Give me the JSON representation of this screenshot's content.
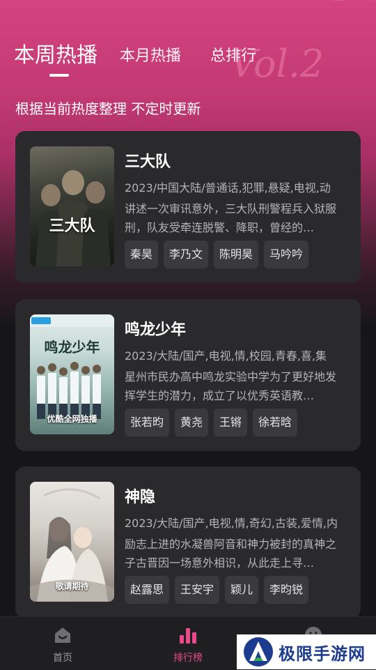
{
  "tabs": [
    {
      "label": "本周热播",
      "active": true
    },
    {
      "label": "本月热播",
      "active": false
    },
    {
      "label": "总排行",
      "active": false
    }
  ],
  "subtitle": "根据当前热度整理 不定时更新",
  "cards": [
    {
      "title": "三大队",
      "meta": "2023/中国大陆/普通话,犯罪,悬疑,电视,动",
      "desc": "讲述一次审讯意外，三大队刑警程兵入狱服刑，队友受牵连脱警、降职，曾经的…",
      "poster_title": "三大队",
      "poster_caption": "",
      "tags": [
        "秦昊",
        "李乃文",
        "陈明昊",
        "马吟吟"
      ]
    },
    {
      "title": "鸣龙少年",
      "meta": "2023/大陆/国产,电视,情,校园,青春,喜,集",
      "desc": "星州市民办高中鸣龙实验中学为了更好地发挥学生的潜力，成立了以优秀英语教…",
      "poster_title": "鸣龙少年",
      "poster_caption": "优酷全网独播",
      "tags": [
        "张若昀",
        "黄尧",
        "王锵",
        "徐若晗"
      ]
    },
    {
      "title": "神隐",
      "meta": "2023/大陆/国产,电视,情,奇幻,古装,爱情,内",
      "desc": "励志上进的水凝兽阿音和神力被封的真神之子古晋因一场意外相识，从此走上寻…",
      "poster_title": "",
      "poster_caption": "敬请期待",
      "tags": [
        "赵露思",
        "王安宇",
        "颖儿",
        "李昀锐"
      ]
    }
  ],
  "nav": [
    {
      "label": "首页",
      "icon": "home-icon",
      "active": false
    },
    {
      "label": "排行榜",
      "icon": "chart-bars-icon",
      "active": true
    },
    {
      "label": "",
      "icon": "smiley-icon",
      "active": false
    }
  ],
  "watermark": {
    "text": "极限手游网"
  },
  "colors": {
    "accent": "#e84a8c",
    "hero_top": "#d2437f",
    "card": "#2a2a2d",
    "background": "#161618"
  }
}
